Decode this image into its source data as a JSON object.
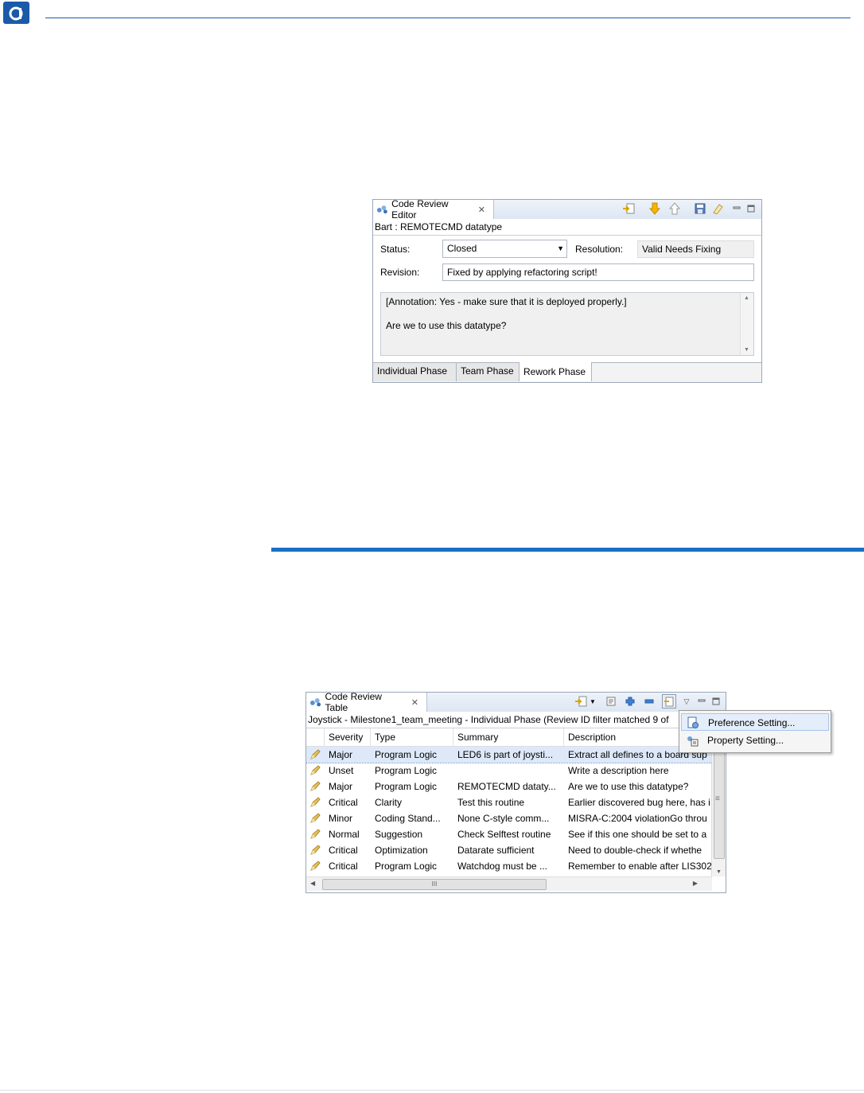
{
  "editor": {
    "tab_title": "Code Review Editor",
    "subtitle": "Bart : REMOTECMD datatype",
    "status_label": "Status:",
    "status_value": "Closed",
    "resolution_label": "Resolution:",
    "resolution_value": "Valid Needs Fixing",
    "revision_label": "Revision:",
    "revision_value": "Fixed by applying refactoring script!",
    "annotation_line": "[Annotation:  Yes - make sure that it is deployed properly.]",
    "description_line": "Are we to use this datatype?",
    "phase_tabs": [
      "Individual Phase",
      "Team Phase",
      "Rework Phase"
    ]
  },
  "table": {
    "tab_title": "Code Review Table",
    "subtitle": "Joystick - Milestone1_team_meeting - Individual Phase (Review ID filter matched 9 of",
    "columns": [
      "Severity",
      "Type",
      "Summary",
      "Description"
    ],
    "rows": [
      [
        "Major",
        "Program Logic",
        "LED6 is part of joysti...",
        "Extract all defines to a board sup"
      ],
      [
        "Unset",
        "Program Logic",
        "",
        "Write a description here"
      ],
      [
        "Major",
        "Program Logic",
        "REMOTECMD dataty...",
        "Are we to use this datatype?"
      ],
      [
        "Critical",
        "Clarity",
        "Test this routine",
        "Earlier discovered bug here, has i"
      ],
      [
        "Minor",
        "Coding Stand...",
        "None C-style comm...",
        "MISRA-C:2004 violationGo throu"
      ],
      [
        "Normal",
        "Suggestion",
        "Check Selftest routine",
        "See if this one should be set to a"
      ],
      [
        "Critical",
        "Optimization",
        "Datarate sufficient",
        "Need to double-check if whethe"
      ],
      [
        "Critical",
        "Program Logic",
        "Watchdog must be ...",
        "Remember to enable after LIS302"
      ]
    ],
    "hscroll_grip": "III"
  },
  "menu": {
    "items": [
      "Preference Setting...",
      "Property Setting..."
    ]
  },
  "icons": {
    "view_icon": "review-icon",
    "row_icon": "pencil-icon"
  },
  "colors": {
    "brand_blue": "#1a5aa8",
    "selection": "#dde9f8"
  }
}
